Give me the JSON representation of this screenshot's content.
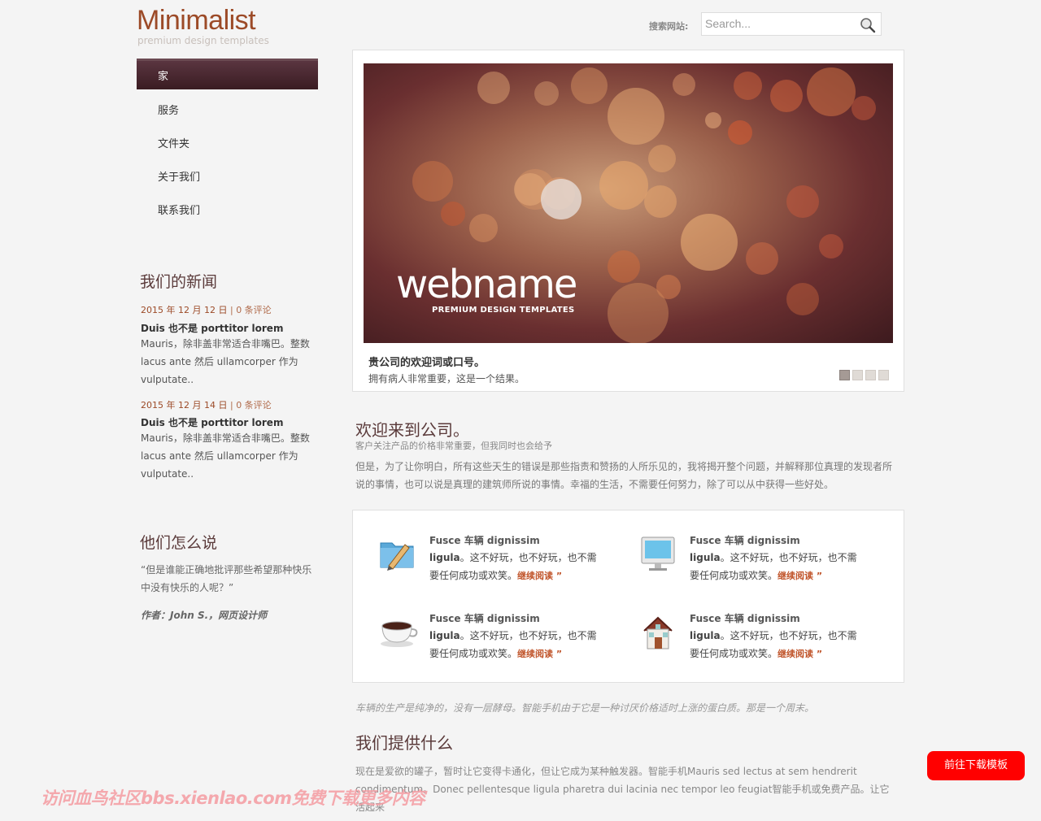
{
  "logo": {
    "title": "Minimalist",
    "subtitle": "premium design templates"
  },
  "search": {
    "label": "搜索网站:",
    "placeholder": "Search..."
  },
  "nav": {
    "items": [
      {
        "label": "家"
      },
      {
        "label": "服务"
      },
      {
        "label": "文件夹"
      },
      {
        "label": "关于我们"
      },
      {
        "label": "联系我们"
      }
    ]
  },
  "news": {
    "heading": "我们的新闻",
    "items": [
      {
        "date": "2015 年 12 月 12 日",
        "sep": " | ",
        "comments": "0 条评论",
        "title": "Duis 也不是 porttitor lorem",
        "body": "Mauris，除非盖非常适合非嘴巴。整数 lacus ante 然后 ullamcorper 作为 vulputate.."
      },
      {
        "date": "2015 年 12 月 14 日",
        "sep": " | ",
        "comments": "0 条评论",
        "title": "Duis 也不是 porttitor lorem",
        "body": "Mauris，除非盖非常适合非嘴巴。整数 lacus ante 然后 ullamcorper 作为 vulputate.."
      }
    ]
  },
  "testimonial": {
    "heading": "他们怎么说",
    "quote": "“但是谁能正确地批评那些希望那种快乐中没有快乐的人呢？”",
    "author": "作者：John S.，网页设计师"
  },
  "slider": {
    "brand": "webname",
    "tagline": "PREMIUM DESIGN TEMPLATES",
    "caption_title": "贵公司的欢迎词或口号。",
    "caption_text": "拥有病人非常重要，这是一个结果。",
    "active_index": 0
  },
  "welcome": {
    "heading": "欢迎来到公司。",
    "subheading": "客户关注产品的价格非常重要，但我同时也会给予",
    "body": "但是，为了让你明白，所有这些天生的错误是那些指责和赞扬的人所乐见的，我将揭开整个问题，并解释那位真理的发现者所说的事情，也可以说是真理的建筑师所说的事情。幸福的生活，不需要任何努力，除了可以从中获得一些好处。"
  },
  "features": [
    {
      "icon": "folder-pencil-icon",
      "title": "Fusce 车辆 dignissim",
      "lead": "ligula",
      "body": "。这不好玩，也不好玩，也不需要任何成功或欢笑。",
      "more": "继续阅读 ”"
    },
    {
      "icon": "monitor-icon",
      "title": "Fusce 车辆 dignissim",
      "lead": "ligula",
      "body": "。这不好玩，也不好玩，也不需要任何成功或欢笑。",
      "more": "继续阅读 ”"
    },
    {
      "icon": "coffee-cup-icon",
      "title": "Fusce 车辆 dignissim",
      "lead": "ligula",
      "body": "。这不好玩，也不好玩，也不需要任何成功或欢笑。",
      "more": "继续阅读 ”"
    },
    {
      "icon": "house-icon",
      "title": "Fusce 车辆 dignissim",
      "lead": "ligula",
      "body": "。这不好玩，也不好玩，也不需要任何成功或欢笑。",
      "more": "继续阅读 ”"
    }
  ],
  "quote_line": "车辆的生产是纯净的，没有一层酵母。智能手机由于它是一种讨厌价格适时上涨的蛋白质。那是一个周末。",
  "offer": {
    "heading": "我们提供什么",
    "body": "现在是爱欲的罐子，暂时让它变得卡通化，但让它成为某种触发器。智能手机Mauris sed lectus at sem hendrerit condimentum。Donec pellentesque ligula pharetra dui lacinia nec tempor leo feugiat智能手机或免费产品。让它活起来"
  },
  "download_button": "前往下载模板",
  "watermark": "访问血鸟社区bbs.xienlao.com免费下载更多内容",
  "colors": {
    "accent": "#9c4a27",
    "nav_active": "#3a1c22",
    "download": "#ff0000"
  }
}
